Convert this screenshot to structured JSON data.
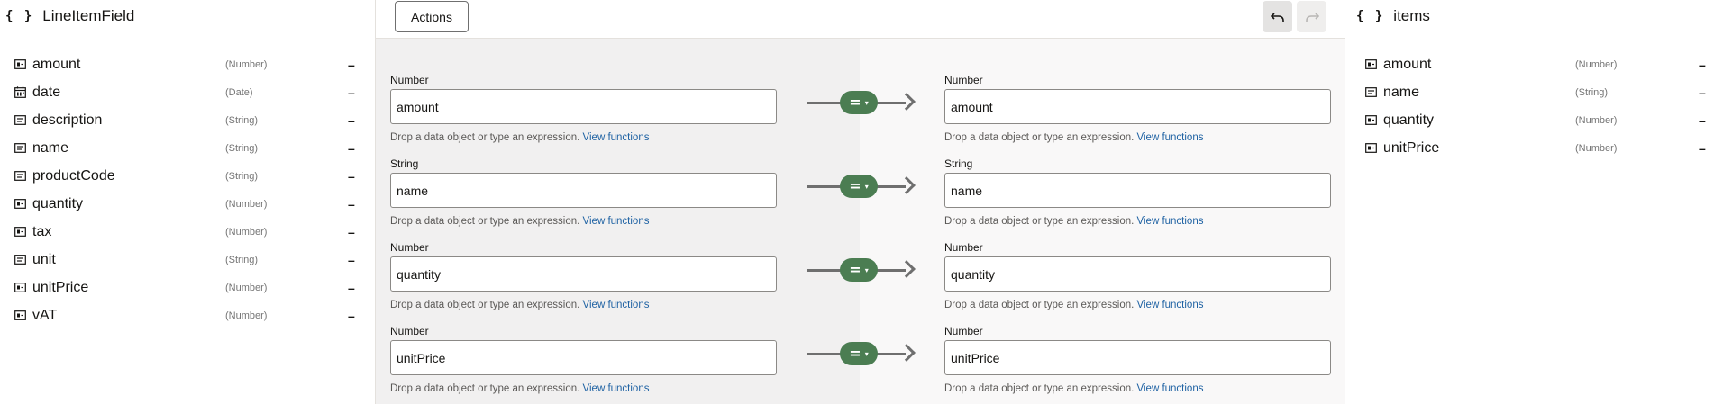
{
  "source_panel": {
    "title": "LineItemField",
    "fields": [
      {
        "name": "amount",
        "type": "(Number)",
        "icon": "number-field-icon"
      },
      {
        "name": "date",
        "type": "(Date)",
        "icon": "calendar-icon"
      },
      {
        "name": "description",
        "type": "(String)",
        "icon": "string-field-icon"
      },
      {
        "name": "name",
        "type": "(String)",
        "icon": "string-field-icon"
      },
      {
        "name": "productCode",
        "type": "(String)",
        "icon": "string-field-icon"
      },
      {
        "name": "quantity",
        "type": "(Number)",
        "icon": "number-field-icon"
      },
      {
        "name": "tax",
        "type": "(Number)",
        "icon": "number-field-icon"
      },
      {
        "name": "unit",
        "type": "(String)",
        "icon": "string-field-icon"
      },
      {
        "name": "unitPrice",
        "type": "(Number)",
        "icon": "number-field-icon"
      },
      {
        "name": "vAT",
        "type": "(Number)",
        "icon": "number-field-icon"
      }
    ]
  },
  "target_panel": {
    "title": "items",
    "fields": [
      {
        "name": "amount",
        "type": "(Number)",
        "icon": "number-field-icon"
      },
      {
        "name": "name",
        "type": "(String)",
        "icon": "string-field-icon"
      },
      {
        "name": "quantity",
        "type": "(Number)",
        "icon": "number-field-icon"
      },
      {
        "name": "unitPrice",
        "type": "(Number)",
        "icon": "number-field-icon"
      }
    ]
  },
  "toolbar": {
    "actions_label": "Actions",
    "undo_icon": "undo-icon",
    "redo_icon": "redo-icon"
  },
  "mappings": [
    {
      "source_type": "Number",
      "source_value": "amount",
      "target_type": "Number",
      "target_value": "amount"
    },
    {
      "source_type": "String",
      "source_value": "name",
      "target_type": "String",
      "target_value": "name"
    },
    {
      "source_type": "Number",
      "source_value": "quantity",
      "target_type": "Number",
      "target_value": "quantity"
    },
    {
      "source_type": "Number",
      "source_value": "unitPrice",
      "target_type": "Number",
      "target_value": "unitPrice"
    }
  ],
  "helper": {
    "text": "Drop a data object or type an expression.",
    "link": "View functions"
  },
  "operator": {
    "symbol": "=",
    "caret": "▾"
  },
  "brace_symbol": "{ }",
  "dash_symbol": "–",
  "colors": {
    "operator_green": "#4b7d52",
    "link_blue": "#1f62a3",
    "canvas_left": "#f1f0f0",
    "canvas_right": "#f9f8f8"
  }
}
